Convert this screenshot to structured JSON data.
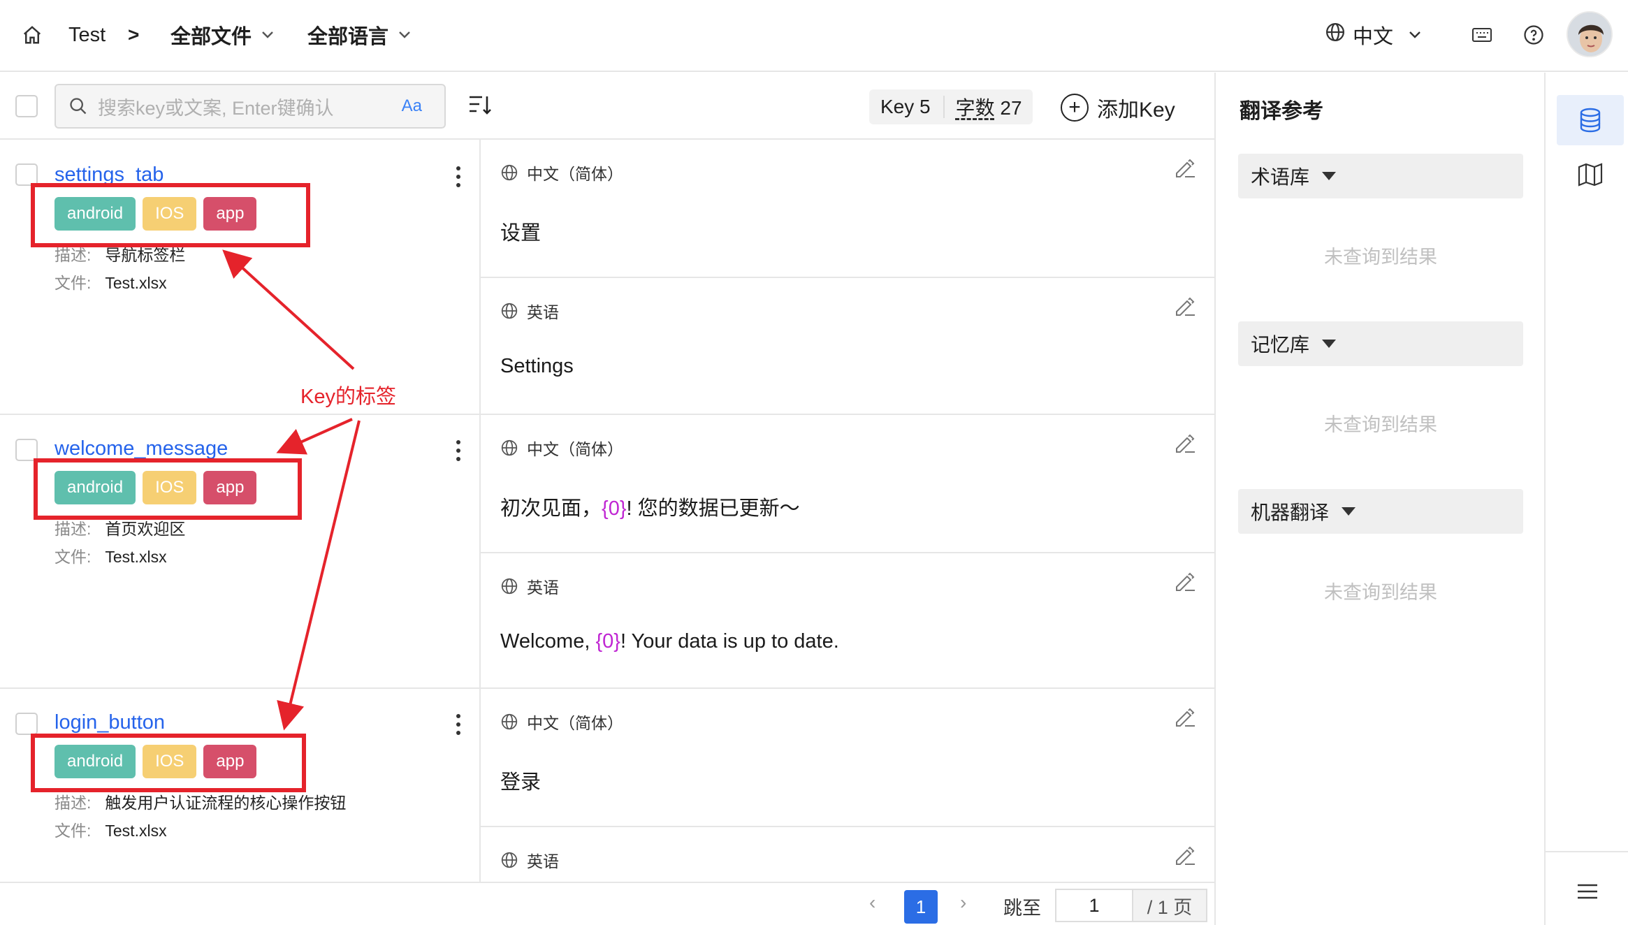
{
  "topbar": {
    "breadcrumb_root": "Test",
    "breadcrumb_sep": ">",
    "files_filter": "全部文件",
    "lang_filter": "全部语言",
    "ui_language": "中文",
    "icons": [
      "home-icon",
      "chevron-down-icon",
      "globe-icon",
      "keyboard-icon",
      "help-icon",
      "avatar"
    ]
  },
  "toolbar": {
    "search_placeholder": "搜索key或文案, Enter键确认",
    "case_toggle": "Aa",
    "key_label": "Key",
    "key_count": "5",
    "word_label": "字数",
    "word_count": "27",
    "add_key_label": "添加Key"
  },
  "meta_labels": {
    "desc": "描述:",
    "file": "文件:"
  },
  "keys": [
    {
      "name": "settings_tab",
      "tags": [
        "android",
        "IOS",
        "app"
      ],
      "desc": "导航标签栏",
      "file": "Test.xlsx",
      "translations": [
        {
          "lang": "中文（简体）",
          "text": "设置"
        },
        {
          "lang": "英语",
          "text": "Settings"
        }
      ]
    },
    {
      "name": "welcome_message",
      "tags": [
        "android",
        "IOS",
        "app"
      ],
      "desc": "首页欢迎区",
      "file": "Test.xlsx",
      "translations": [
        {
          "lang": "中文（简体）",
          "text_before": "初次见面，",
          "placeholder": "{0}",
          "text_after": "! 您的数据已更新～"
        },
        {
          "lang": "英语",
          "text_before": "Welcome, ",
          "placeholder": "{0}",
          "text_after": "! Your data is up to date."
        }
      ]
    },
    {
      "name": "login_button",
      "tags": [
        "android",
        "IOS",
        "app"
      ],
      "desc": "触发用户认证流程的核心操作按钮",
      "file": "Test.xlsx",
      "translations": [
        {
          "lang": "中文（简体）",
          "text": "登录"
        },
        {
          "lang": "英语",
          "text": ""
        }
      ]
    }
  ],
  "pagination": {
    "prev": "‹",
    "current": "1",
    "next": "›",
    "jump_label": "跳至",
    "jump_value": "1",
    "total": "/ 1 页"
  },
  "reference": {
    "title": "翻译参考",
    "sections": [
      {
        "label": "术语库",
        "empty": "未查询到结果"
      },
      {
        "label": "记忆库",
        "empty": "未查询到结果"
      },
      {
        "label": "机器翻译",
        "empty": "未查询到结果"
      }
    ]
  },
  "annotation": {
    "label": "Key的标签",
    "color": "#e5232b"
  },
  "colors": {
    "accent": "#2b6de5",
    "tag_android": "#5fbfad",
    "tag_ios": "#f6cf73",
    "tag_app": "#d64f6a",
    "placeholder": "#c026d3"
  }
}
